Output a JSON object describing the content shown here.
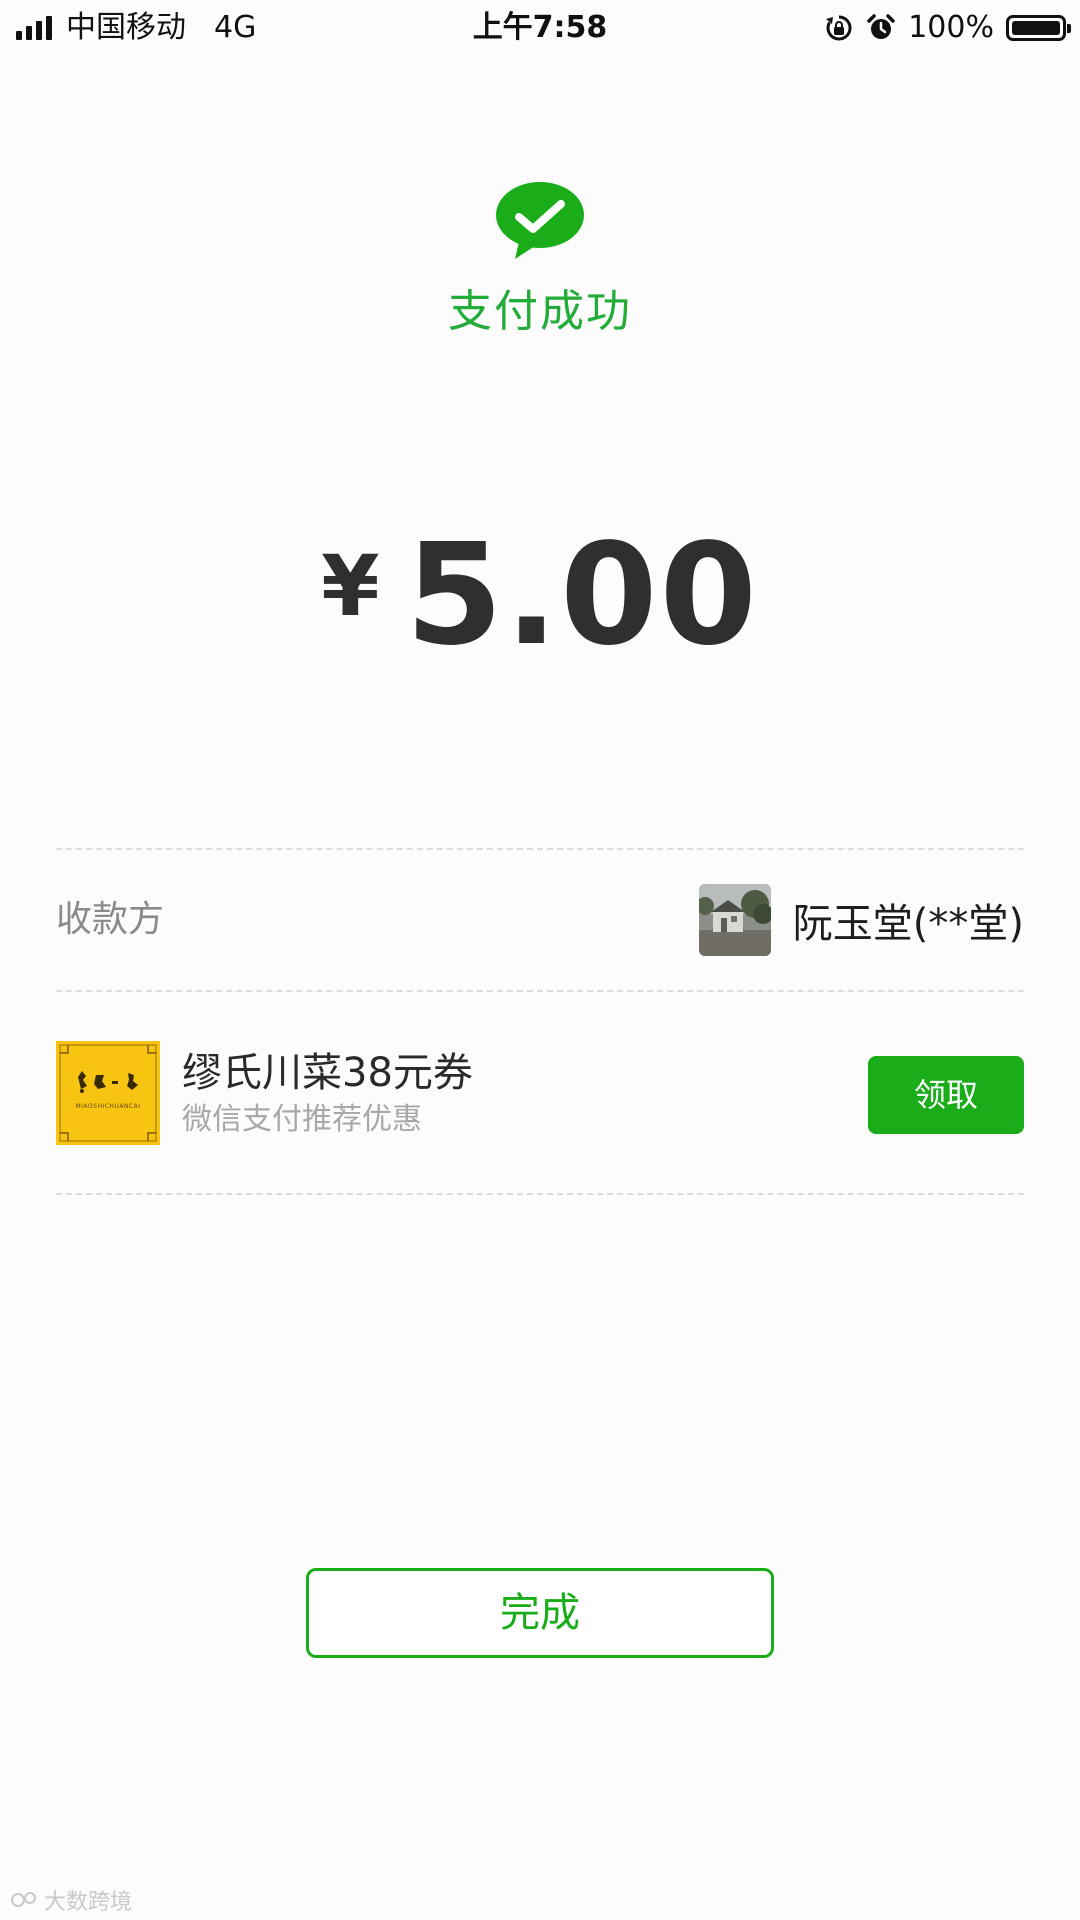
{
  "status_bar": {
    "carrier": "中国移动",
    "network": "4G",
    "time": "上午7:58",
    "battery_percent": "100%",
    "icons": [
      "signal-icon",
      "rotation-lock-icon",
      "alarm-icon",
      "battery-icon"
    ]
  },
  "payment": {
    "status_title": "支付成功",
    "currency_symbol": "¥",
    "amount": "5.00",
    "status_icon": "wechat-pay-check-icon"
  },
  "payee": {
    "label": "收款方",
    "name": "阮玉堂(**堂)",
    "avatar": "payee-avatar-photo"
  },
  "coupon": {
    "title": "缪氏川菜38元券",
    "subtitle": "微信支付推荐优惠",
    "button_label": "领取",
    "logo_text": "MIAOSHICHUANCAI"
  },
  "done_button_label": "完成",
  "watermark": "大数跨境",
  "colors": {
    "accent_green": "#1aad19",
    "title_green": "#22ac38",
    "coupon_logo_yellow": "#f7c411",
    "background": "#fdfcfd"
  }
}
